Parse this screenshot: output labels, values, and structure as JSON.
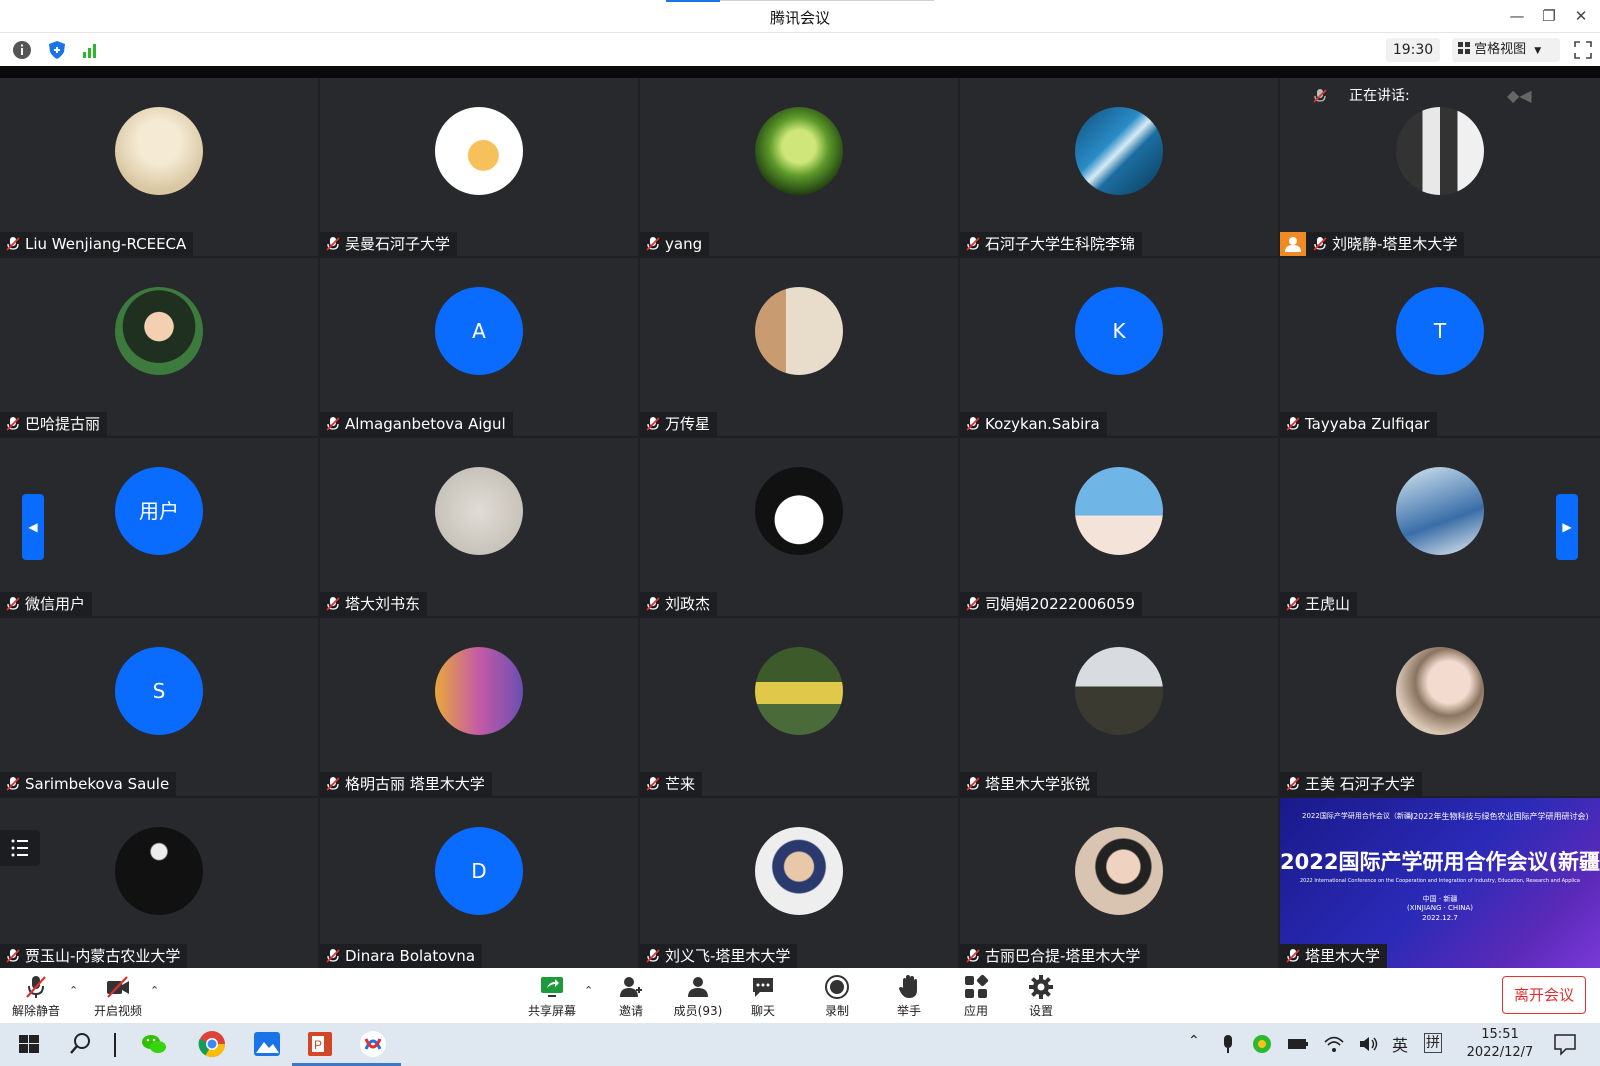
{
  "window": {
    "title": "腾讯会议"
  },
  "toolbar": {
    "time": "19:30",
    "view_mode": "宫格视图"
  },
  "speaking": {
    "label": "正在讲话:"
  },
  "participants": [
    {
      "name": "Liu Wenjiang-RCEECA",
      "avatar": "sketch"
    },
    {
      "name": "吴曼石河子大学",
      "avatar": "cartoon-girl"
    },
    {
      "name": "yang",
      "avatar": "green-plant"
    },
    {
      "name": "石河子大学生科院李锦",
      "avatar": "ocean-wave"
    },
    {
      "name": "刘晓静-塔里木大学",
      "avatar": "penguins"
    },
    {
      "name": "巴哈提古丽",
      "avatar": "drawn-woman"
    },
    {
      "name": "Almaganbetova Aigul",
      "avatar": "letter",
      "letter": "A"
    },
    {
      "name": "万传星",
      "avatar": "calligraphy"
    },
    {
      "name": "Kozykan.Sabira",
      "avatar": "letter",
      "letter": "K"
    },
    {
      "name": "Tayyaba Zulfiqar",
      "avatar": "letter",
      "letter": "T"
    },
    {
      "name": "微信用户",
      "avatar": "letter",
      "letter": "用户"
    },
    {
      "name": "塔大刘书东",
      "avatar": "paper-text"
    },
    {
      "name": "刘政杰",
      "avatar": "anime-girl"
    },
    {
      "name": "司娟娟20222006059",
      "avatar": "cartoon-wait"
    },
    {
      "name": "王虎山",
      "avatar": "ink-painting"
    },
    {
      "name": "Sarimbekova Saule",
      "avatar": "letter",
      "letter": "S"
    },
    {
      "name": "格明古丽 塔里木大学",
      "avatar": "family-silhouette"
    },
    {
      "name": "芒来",
      "avatar": "group-photo"
    },
    {
      "name": "塔里木大学张锐",
      "avatar": "landscape-person"
    },
    {
      "name": "王美 石河子大学",
      "avatar": "woman-cat"
    },
    {
      "name": "贾玉山-内蒙古农业大学",
      "avatar": "moon-night"
    },
    {
      "name": "Dinara Bolatovna",
      "avatar": "letter",
      "letter": "D"
    },
    {
      "name": "刘义飞-塔里木大学",
      "avatar": "man-portrait"
    },
    {
      "name": "古丽巴合提-塔里木大学",
      "avatar": "woman-portrait"
    },
    {
      "name": "塔里木大学",
      "avatar": "screen-share"
    }
  ],
  "screenshare": {
    "header_left": "2022国际产学研用合作会议（新疆）",
    "header_right": "(2022年生物科技与绿色农业国际产学研用研讨会)",
    "title": "2022国际产学研用合作会议(新疆)",
    "subtitle": "2022 International Conference on the Cooperation and Integration of Industry, Education, Research and Application",
    "loc1": "中国 · 新疆",
    "loc2": "(XINJIANG · CHINA)",
    "date": "2022.12.7"
  },
  "bottombar": {
    "unmute": "解除静音",
    "video": "开启视频",
    "share": "共享屏幕",
    "invite": "邀请",
    "members": "成员(93)",
    "chat": "聊天",
    "record": "录制",
    "raise_hand": "举手",
    "apps": "应用",
    "settings": "设置",
    "leave": "离开会议"
  },
  "taskbar": {
    "ime_lang": "英",
    "ime_mode": "拼",
    "time": "15:51",
    "date": "2022/12/7"
  },
  "colors": {
    "accent": "#0a6cff",
    "tile": "#27292d",
    "leave": "#e03030"
  }
}
